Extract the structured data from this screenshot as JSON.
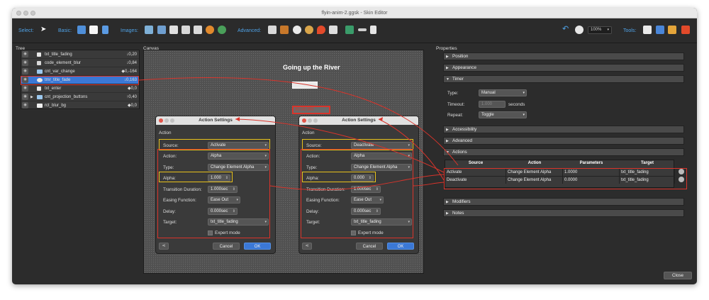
{
  "window": {
    "title": "flyin-anim-2.ggsk - Skin Editor"
  },
  "toolbar": {
    "select_label": "Select:",
    "basic_label": "Basic:",
    "images_label": "Images:",
    "advanced_label": "Advanced:",
    "tools_label": "Tools:",
    "zoom": "100%"
  },
  "panels": {
    "tree": "Tree",
    "canvas": "Canvas",
    "properties": "Properties"
  },
  "tree": [
    {
      "name": "txt_title_fading",
      "value": "↓0,20",
      "icon": "text-icon"
    },
    {
      "name": "code_element_blur",
      "value": "↓0,84",
      "icon": "code-icon"
    },
    {
      "name": "cnt_var_change",
      "value": "◆0,-164",
      "icon": "container-icon"
    },
    {
      "name": "tmr_title_fade",
      "value": "↓0,163",
      "icon": "timer-icon",
      "selected": true
    },
    {
      "name": "txt_enter",
      "value": "◆0,0",
      "icon": "text-icon"
    },
    {
      "name": "cnt_projection_buttons",
      "value": "↑0,40",
      "icon": "container-icon"
    },
    {
      "name": "rct_blur_bg",
      "value": "◆0,0",
      "icon": "rectangle-icon"
    }
  ],
  "canvas": {
    "title": "Going up the River",
    "timer_label": "00:00:000"
  },
  "dialogs": [
    {
      "title": "Action Settings",
      "section": "Action",
      "source_label": "Source:",
      "source_value": "Activate",
      "action_label": "Action:",
      "action_value": "Alpha",
      "type_label": "Type:",
      "type_value": "Change Element Alpha",
      "alpha_label": "Alpha:",
      "alpha_value": "1.000",
      "duration_label": "Transition Duration:",
      "duration_value": "1.000sec",
      "easing_label": "Easing Function:",
      "easing_value": "Ease Out",
      "delay_label": "Delay:",
      "delay_value": "0.000sec",
      "target_label": "Target:",
      "target_value": "txt_title_fading",
      "expert_label": "Expert mode",
      "cancel": "Cancel",
      "ok": "OK"
    },
    {
      "title": "Action Settings",
      "section": "Action",
      "source_label": "Source:",
      "source_value": "Deactivate",
      "action_label": "Action:",
      "action_value": "Alpha",
      "type_label": "Type:",
      "type_value": "Change Element Alpha",
      "alpha_label": "Alpha:",
      "alpha_value": "0.000",
      "duration_label": "Transition Duration:",
      "duration_value": "1.000sec",
      "easing_label": "Easing Function:",
      "easing_value": "Ease Out",
      "delay_label": "Delay:",
      "delay_value": "0.000sec",
      "target_label": "Target:",
      "target_value": "txt_title_fading",
      "expert_label": "Expert mode",
      "cancel": "Cancel",
      "ok": "OK"
    }
  ],
  "properties": {
    "sections": [
      "Position",
      "Appearance",
      "Timer",
      "Accessibility",
      "Advanced",
      "Actions",
      "Modifiers",
      "Notes"
    ],
    "timer": {
      "type_label": "Type:",
      "type_value": "Manual",
      "timeout_label": "Timeout:",
      "timeout_value": "1.000",
      "timeout_unit": "seconds",
      "repeat_label": "Repeat:",
      "repeat_value": "Toggle"
    },
    "actions_table": {
      "headers": [
        "Source",
        "Action",
        "Parameters",
        "Target"
      ],
      "rows": [
        [
          "Activate",
          "Change Element Alpha",
          "1.0000",
          "txt_title_fading"
        ],
        [
          "Deactivate",
          "Change Element Alpha",
          "0.0000",
          "txt_title_fading"
        ]
      ]
    }
  },
  "close_button": "Close",
  "colors": {
    "accent": "#3b78d6",
    "highlight_red": "#d9342b",
    "highlight_yellow": "#e8c21b"
  }
}
